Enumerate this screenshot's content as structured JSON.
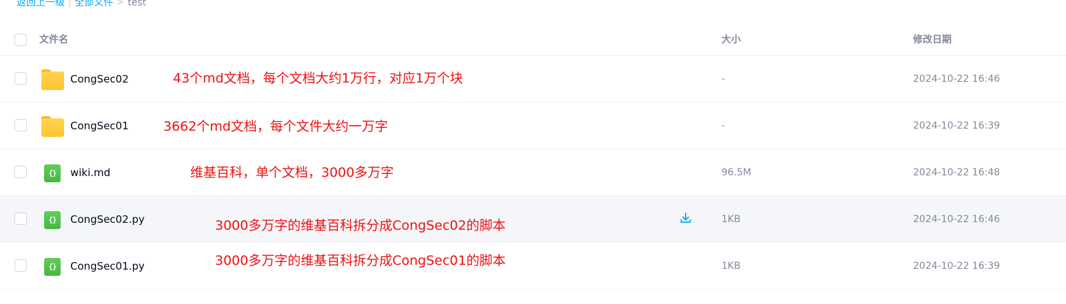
{
  "breadcrumb": {
    "back_label": "返回上一级",
    "separator_1": "|",
    "all_files_label": "全部文件",
    "separator_2": ">",
    "current": "test"
  },
  "table": {
    "columns": {
      "name": "文件名",
      "size": "大小",
      "modified": "修改日期"
    },
    "rows": [
      {
        "name": "CongSec02",
        "type_icon": "folder-icon",
        "size": "-",
        "modified": "2024-10-22 16:46"
      },
      {
        "name": "CongSec01",
        "type_icon": "folder-icon",
        "size": "-",
        "modified": "2024-10-22 16:39"
      },
      {
        "name": "wiki.md",
        "type_icon": "code-file-icon",
        "size": "96.5M",
        "modified": "2024-10-22 16:48"
      },
      {
        "name": "CongSec02.py",
        "type_icon": "code-file-icon",
        "size": "1KB",
        "modified": "2024-10-22 16:46",
        "hovered": true,
        "row_action": "download-icon"
      },
      {
        "name": "CongSec01.py",
        "type_icon": "code-file-icon",
        "size": "1KB",
        "modified": "2024-10-22 16:39"
      }
    ]
  },
  "annotations": [
    "43个md文档，每个文档大约1万行，对应1万个块",
    "3662个md文档，每个文件大约一万字",
    "维基百科，单个文档，3000多万字",
    "3000多万字的维基百科拆分成CongSec02的脚本",
    "3000多万字的维基百科拆分成CongSec01的脚本"
  ],
  "colors": {
    "link": "#06a7ff",
    "muted_text": "#818999",
    "annotation": "#ee1111",
    "folder": "#fec52d",
    "code_file": "#47b742",
    "row_hover": "#f5f6fa"
  },
  "icons": {
    "file_code_glyph": "{}"
  }
}
